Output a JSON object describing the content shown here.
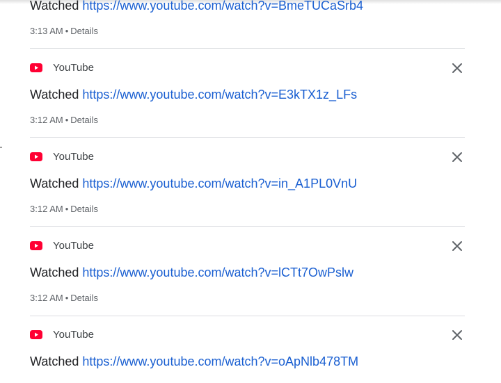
{
  "watched_prefix": "Watched",
  "details_label": "Details",
  "separator": "•",
  "product_name": "YouTube",
  "product_icon": "youtube-icon",
  "close_icon": "close-icon",
  "colors": {
    "link": "#1a5fd1",
    "youtube_red": "#ff0033",
    "text": "#202124",
    "meta": "#5f6368"
  },
  "entries": [
    {
      "url": "https://www.youtube.com/watch?v=BmeTUCaSrb4",
      "time": "3:13 AM"
    },
    {
      "url": "https://www.youtube.com/watch?v=E3kTX1z_LFs",
      "time": "3:12 AM"
    },
    {
      "url": "https://www.youtube.com/watch?v=in_A1PL0VnU",
      "time": "3:12 AM"
    },
    {
      "url": "https://www.youtube.com/watch?v=lCTt7OwPslw",
      "time": "3:12 AM"
    },
    {
      "url": "https://www.youtube.com/watch?v=oApNlb478TM"
    }
  ]
}
